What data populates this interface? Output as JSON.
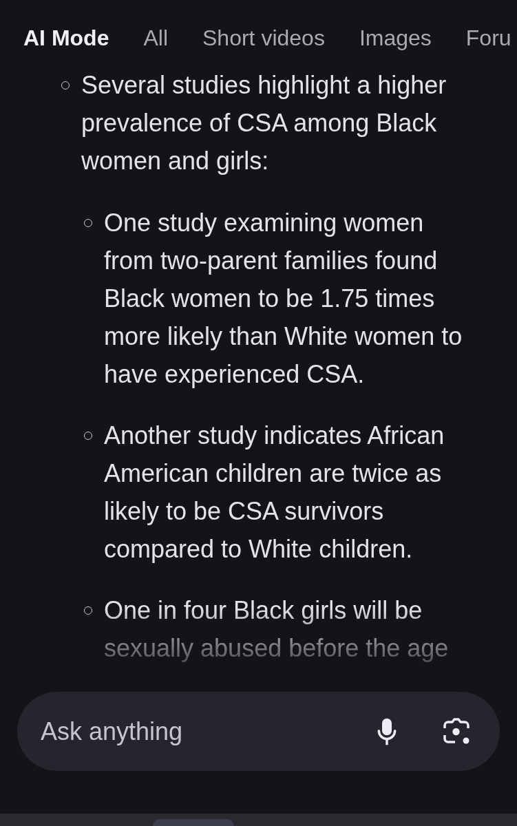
{
  "tabs": [
    {
      "label": "AI Mode",
      "selected": true
    },
    {
      "label": "All",
      "selected": false
    },
    {
      "label": "Short videos",
      "selected": false
    },
    {
      "label": "Images",
      "selected": false
    },
    {
      "label": "Foru",
      "selected": false
    }
  ],
  "answer": {
    "items": [
      {
        "text": "Several studies highlight a higher prevalence of CSA among Black women and girls:",
        "children": [
          {
            "text": "One study examining women from two-parent families found Black women to be 1.75 times more likely than White women to have experienced CSA."
          },
          {
            "text": "Another study indicates African American children are twice as likely to be CSA survivors compared to White children."
          },
          {
            "text": "One in four Black girls will be sexually abused before the age"
          }
        ]
      }
    ]
  },
  "search": {
    "placeholder": "Ask anything"
  }
}
